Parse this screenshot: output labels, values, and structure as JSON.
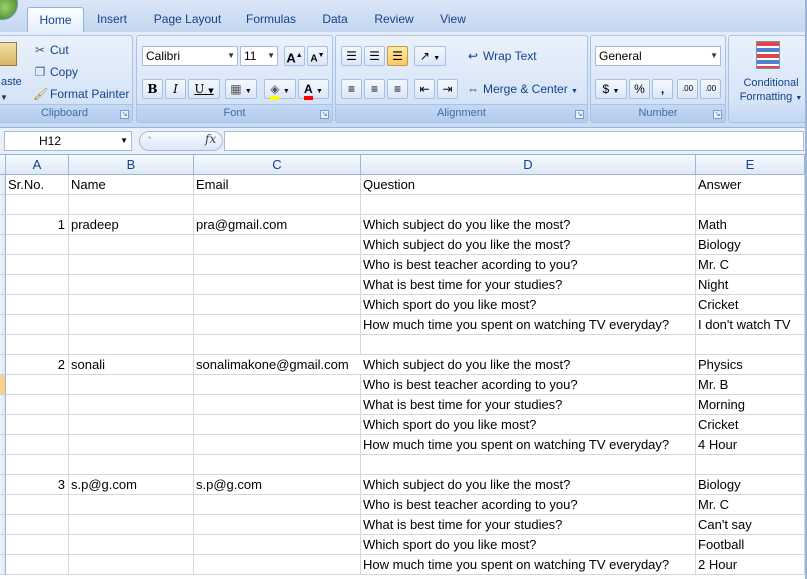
{
  "ribbon": {
    "tabs": [
      {
        "label": "Home",
        "active": true
      },
      {
        "label": "Insert"
      },
      {
        "label": "Page Layout"
      },
      {
        "label": "Formulas"
      },
      {
        "label": "Data"
      },
      {
        "label": "Review"
      },
      {
        "label": "View"
      }
    ],
    "clipboard": {
      "paste": "aste",
      "cut": "Cut",
      "copy": "Copy",
      "format_painter": "Format Painter",
      "label": "Clipboard"
    },
    "font": {
      "name": "Calibri",
      "size": "11",
      "grow": "A",
      "shrink": "A",
      "bold": "B",
      "italic": "I",
      "underline": "U",
      "color_letter": "A",
      "label": "Font"
    },
    "alignment": {
      "wrap_text": "Wrap Text",
      "merge_center": "Merge & Center",
      "label": "Alignment"
    },
    "number": {
      "format": "General",
      "currency": "$",
      "percent": "%",
      "comma": ",",
      "inc_decimal": ".00",
      "dec_decimal": ".00",
      "label": "Number"
    },
    "styles": {
      "conditional_line1": "Conditional",
      "conditional_line2": "Formatting"
    },
    "colors": {
      "fill_highlight": "#ffff00",
      "font_color": "#ff0000",
      "active_button": "#ffc860"
    }
  },
  "formula_bar": {
    "name_box": "H12",
    "fx": "fx",
    "formula": ""
  },
  "sheet": {
    "columns": [
      "A",
      "B",
      "C",
      "D",
      "E"
    ],
    "rows": [
      [
        "Sr.No.",
        "Name",
        "Email",
        "Question",
        "Answer"
      ],
      [
        "",
        "",
        "",
        "",
        ""
      ],
      [
        "1",
        "pradeep",
        "pra@gmail.com",
        "Which subject do you like the most?",
        "Math"
      ],
      [
        "",
        "",
        "",
        "Which subject do you like the most?",
        "Biology"
      ],
      [
        "",
        "",
        "",
        "Who is best teacher acording to you?",
        "Mr. C"
      ],
      [
        "",
        "",
        "",
        "What is best time for your studies?",
        "Night"
      ],
      [
        "",
        "",
        "",
        "Which sport do you like most?",
        "Cricket"
      ],
      [
        "",
        "",
        "",
        "How much time you spent on watching TV everyday?",
        "I don't watch TV"
      ],
      [
        "",
        "",
        "",
        "",
        ""
      ],
      [
        "2",
        "sonali",
        "sonalimakone@gmail.com",
        "Which subject do you like the most?",
        "Physics"
      ],
      [
        "",
        "",
        "",
        "Who is best teacher acording to you?",
        "Mr. B"
      ],
      [
        "",
        "",
        "",
        "What is best time for your studies?",
        "Morning"
      ],
      [
        "",
        "",
        "",
        "Which sport do you like most?",
        "Cricket"
      ],
      [
        "",
        "",
        "",
        "How much time you spent on watching TV everyday?",
        "4 Hour"
      ],
      [
        "",
        "",
        "",
        "",
        ""
      ],
      [
        "3",
        "s.p@g.com",
        "s.p@g.com",
        "Which subject do you like the most?",
        "Biology"
      ],
      [
        "",
        "",
        "",
        "Who is best teacher acording to you?",
        "Mr. C"
      ],
      [
        "",
        "",
        "",
        "What is best time for your studies?",
        "Can't say"
      ],
      [
        "",
        "",
        "",
        "Which sport do you like most?",
        "Football"
      ],
      [
        "",
        "",
        "",
        "How much time you spent on watching TV everyday?",
        "2 Hour"
      ]
    ]
  }
}
